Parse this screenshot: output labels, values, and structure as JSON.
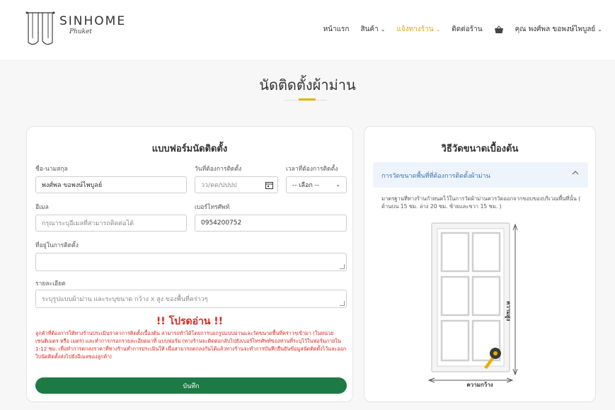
{
  "brand": {
    "name": "SINHOME",
    "sub": "Phuket"
  },
  "nav": {
    "items": [
      {
        "label": "หน้าแรก",
        "has_menu": false,
        "active": false
      },
      {
        "label": "สินค้า",
        "has_menu": true,
        "active": false
      },
      {
        "label": "แจ้งทางร้าน",
        "has_menu": true,
        "active": true
      },
      {
        "label": "ติดต่อร้าน",
        "has_menu": false,
        "active": false
      }
    ],
    "cart_icon": "basket-icon",
    "user_label": "คุณ พงศ์พล ขอพงษ์ไพบูลย์"
  },
  "page": {
    "title": "นัดติดตั้งผ้าม่าน",
    "accent_color": "#e8b100"
  },
  "form": {
    "heading": "แบบฟอร์มนัดติดตั้ง",
    "name_label": "ชื่อ-นามสกุล",
    "name_value": "พงศ์พล ขอพงษ์ไพบูลย์",
    "date_label": "วันที่ต้องการติดตั้ง",
    "date_placeholder": "วว/ดด/ปปปป",
    "time_label": "เวลาที่ต้องการติดตั้ง",
    "time_value": "-- เลือก --",
    "email_label": "อีเมล",
    "email_placeholder": "กรุณาระบุอีเมลที่สามารถติดต่อได้",
    "phone_label": "เบอร์โทรศัพท์",
    "phone_value": "0954200752",
    "address_label": "ที่อยู่ในการติดตั้ง",
    "detail_label": "รายละเอียด",
    "detail_placeholder": "ระบุรูปแบบผ้าม่าน และระบุขนาด กว้าง x สูง ของพื้นที่คร่าวๆ",
    "warning_title": "!! โปรดอ่าน !!",
    "warning_text": "ลูกค้าที่ต้องการให้ทางร้านประเมินราคาการติดตั้งเบื้องต้น สามารถทำได้โดยการบอกรูปแบบม่านและวัดขนาดพื้นที่คร่าวๆเข้ามา (ในหน่วย เซนติเมตร หรือ เมตร) และทำการกรอกรายละเอียดมาที่ แบบฟอร์ม (ทางร้านจะติดต่อกลับไปยังเบอร์โทรศัพท์ของท่านที่ระบุไว้ในฟอร์มภายใน 1-12 ชม. เพื่อทำการตกลงราคาที่ทางร้านทำการประเมินให้ เมื่อสามารถตกลงกันได้แล้วทางร้านจะทำการบันทึกยืนยันข้อมูลนัดติดตั้งไว้และออกใบนัดติดตั้งส่งไปยังอีเมลของลูกค้า)",
    "submit_label": "บันทึก",
    "submit_color": "#1e7a45",
    "warning_color": "#d9261c"
  },
  "guide": {
    "heading": "วิธีวัดขนาดเบื้องต้น",
    "accordion_title": "การวัดขนาดพื้นที่ที่ต้องการติดตั้งผ้าม่าน",
    "text": "มาตรฐานที่ทางร้านกำหนดไว้ในการวัดผ้าม่านควรวัดออกจากขอบของบริเวณพื้นที่นั้น ( ด้านบน 15 ซม. ล่าง 20 ซม. ซ้ายและขวา 15 ซม. )",
    "width_label": "ความกว้าง",
    "height_label": "ความสูง",
    "accent_color": "#3b6fb4"
  }
}
